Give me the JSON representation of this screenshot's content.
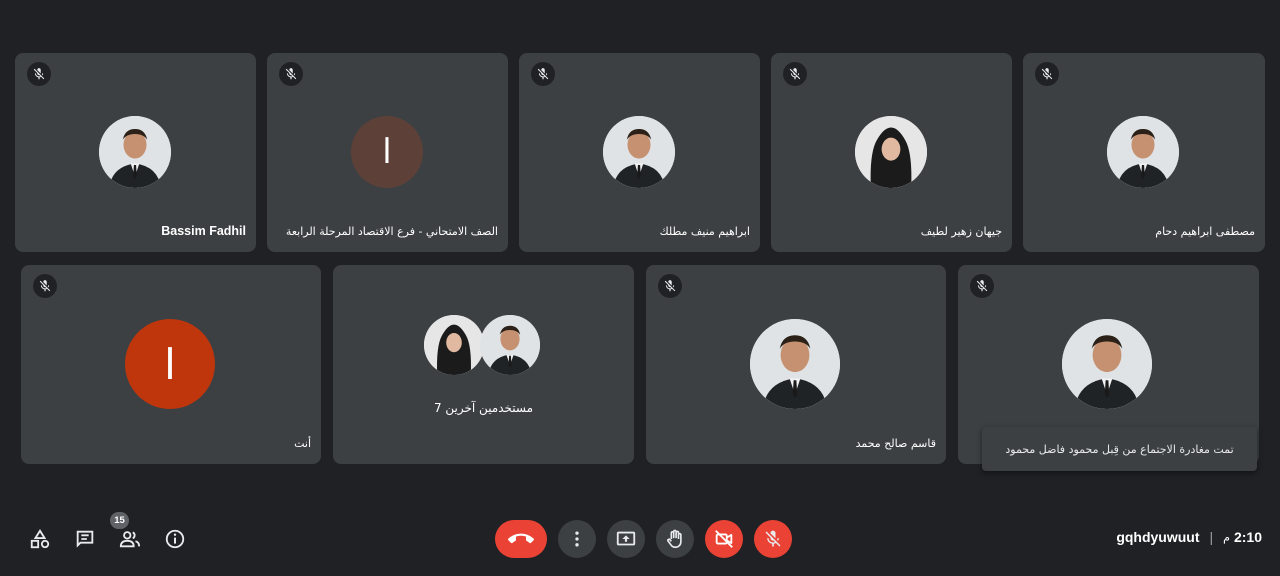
{
  "tiles": [
    {
      "name": "Bassim Fadhil",
      "avatar": "photo"
    },
    {
      "name": "الصف الامتحاني - فرع الاقتصاد المرحلة الرابعة",
      "avatar": "initial",
      "initial": "ا",
      "color": "#5d4037"
    },
    {
      "name": "ابراهيم منيف مطلك",
      "avatar": "photo"
    },
    {
      "name": "جيهان زهير لطيف",
      "avatar": "photo"
    },
    {
      "name": "مصطفى ابراهيم دحام",
      "avatar": "photo"
    },
    {
      "name": "أنت",
      "avatar": "initial",
      "initial": "ا",
      "color": "#bf360c"
    },
    {
      "name": "",
      "group_label": "7 مستخدمين آخرين",
      "avatar": "group"
    },
    {
      "name": "قاسم صالح محمد",
      "avatar": "photo"
    },
    {
      "name": "",
      "avatar": "photo"
    }
  ],
  "toast": "تمت مغادرة الاجتماع من قِبل محمود فاضل محمود",
  "controls": {
    "left": [
      "activities-icon",
      "chat-icon",
      "people-icon",
      "info-icon"
    ],
    "participant_count": "15",
    "center": [
      "end-call",
      "more-options",
      "present-screen",
      "raise-hand",
      "camera-off",
      "mic-off"
    ]
  },
  "meeting": {
    "code": "gqhdyuwuut",
    "separator": "|",
    "time": "2:10",
    "ampm": "م"
  },
  "colors": {
    "background": "#202124",
    "tile": "#3c4043",
    "danger": "#ea4335"
  }
}
